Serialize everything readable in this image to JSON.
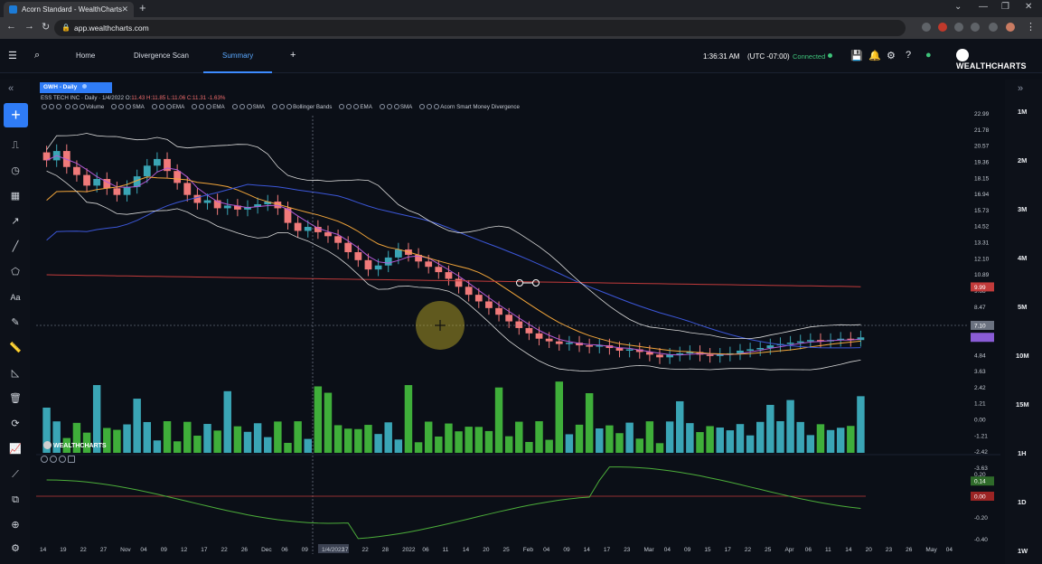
{
  "browser": {
    "tab_title": "Acorn Standard - WealthCharts",
    "tab_close": "✕",
    "new_tab": "+",
    "url": "app.wealthcharts.com",
    "window_controls": [
      "⌄",
      "—",
      "❐",
      "✕"
    ]
  },
  "app_nav": {
    "tabs": [
      {
        "label": "Home",
        "active": false
      },
      {
        "label": "Divergence Scan",
        "active": false
      },
      {
        "label": "Summary",
        "active": true
      }
    ],
    "add_tab": "+",
    "time": "1:36:31 AM",
    "timezone": "(UTC -07:00)",
    "status": "Connected",
    "brand": "WEALTHCHARTS"
  },
  "chart_header": {
    "symbol_tag": "GWH - Daily",
    "ohlc_prefix": "ESS TECH INC  · Daily · 1/4/2022 O:",
    "ohlc_values": "11.43 H:11.85 L:11.06 C:11.31 -1.63%",
    "indicators": [
      "Volume",
      "SMA",
      "EMA",
      "EMA",
      "SMA",
      "Bollinger Bands",
      "EMA",
      "SMA",
      "Acorn Smart Money Divergence"
    ]
  },
  "right_panel": {
    "intervals": [
      "1M",
      "2M",
      "3M",
      "4M",
      "5M",
      "10M",
      "15M",
      "1H",
      "1D",
      "1W"
    ]
  },
  "chart_data": {
    "type": "candlestick",
    "price_axis_ticks": [
      "22.99",
      "21.78",
      "20.57",
      "19.36",
      "18.15",
      "16.94",
      "15.73",
      "14.52",
      "13.31",
      "12.10",
      "10.89",
      "9.68",
      "8.47",
      "7.26",
      "6.05",
      "4.84",
      "3.63",
      "2.42",
      "1.21",
      "0.00",
      "-1.21",
      "-2.42",
      "-3.63"
    ],
    "price_range": [
      -3.63,
      22.99
    ],
    "price_labels": {
      "sma_200": "9.99",
      "crosshair": "7.10"
    },
    "close_series": [
      19.5,
      20.2,
      19.0,
      18.4,
      17.6,
      18.1,
      17.4,
      16.9,
      17.5,
      18.3,
      19.1,
      19.6,
      18.7,
      17.8,
      16.9,
      16.3,
      16.5,
      15.9,
      16.1,
      15.8,
      16.0,
      16.2,
      16.4,
      15.9,
      14.8,
      14.2,
      14.5,
      14.1,
      13.8,
      13.3,
      12.6,
      12.0,
      11.3,
      11.6,
      12.2,
      12.8,
      12.4,
      11.9,
      11.5,
      11.1,
      10.6,
      10.0,
      9.4,
      8.9,
      8.4,
      7.9,
      7.4,
      6.9,
      6.5,
      6.1,
      5.9,
      5.7,
      5.8,
      5.6,
      5.5,
      5.6,
      5.4,
      5.2,
      5.3,
      5.1,
      4.9,
      4.7,
      4.9,
      5.0,
      5.1,
      4.9,
      4.8,
      4.9,
      5.0,
      5.2,
      5.3,
      5.4,
      5.6,
      5.7,
      5.8,
      5.9,
      6.0,
      5.9,
      6.0,
      6.1,
      6.0,
      6.2
    ],
    "bollinger_upper_start": 22.9,
    "sma_200_level": 9.99,
    "crosshair_level": 7.1,
    "volume_axis_ticks": [],
    "subpanel_ticks": [
      "0.20",
      "0.14",
      "0.00",
      "-0.20",
      "-0.40"
    ],
    "subpanel_labels": {
      "value": "0.14",
      "zero": "0.00"
    },
    "x_ticks": [
      "14",
      "19",
      "22",
      "27",
      "Nov",
      "04",
      "09",
      "12",
      "17",
      "22",
      "26",
      "Dec",
      "06",
      "09",
      "1/4/2022",
      "17",
      "22",
      "28",
      "2022",
      "06",
      "11",
      "14",
      "20",
      "25",
      "Feb",
      "04",
      "09",
      "14",
      "17",
      "23",
      "Mar",
      "04",
      "09",
      "15",
      "17",
      "22",
      "25",
      "Apr",
      "06",
      "11",
      "14",
      "20",
      "23",
      "26",
      "May",
      "04"
    ],
    "colors": {
      "up": "#3aa5b5",
      "down": "#f07a7a",
      "bollinger": "#d9d9d9",
      "ema_fast": "#b25ad6",
      "ema_mid": "#f2a53a",
      "sma_long": "#3c57d9",
      "sma_200": "#c23b3b",
      "volume_up": "#3aa5b5",
      "volume_down": "#3fae3a",
      "divergence": "#4cae3a"
    }
  },
  "watermark": "WEALTHCHARTS"
}
